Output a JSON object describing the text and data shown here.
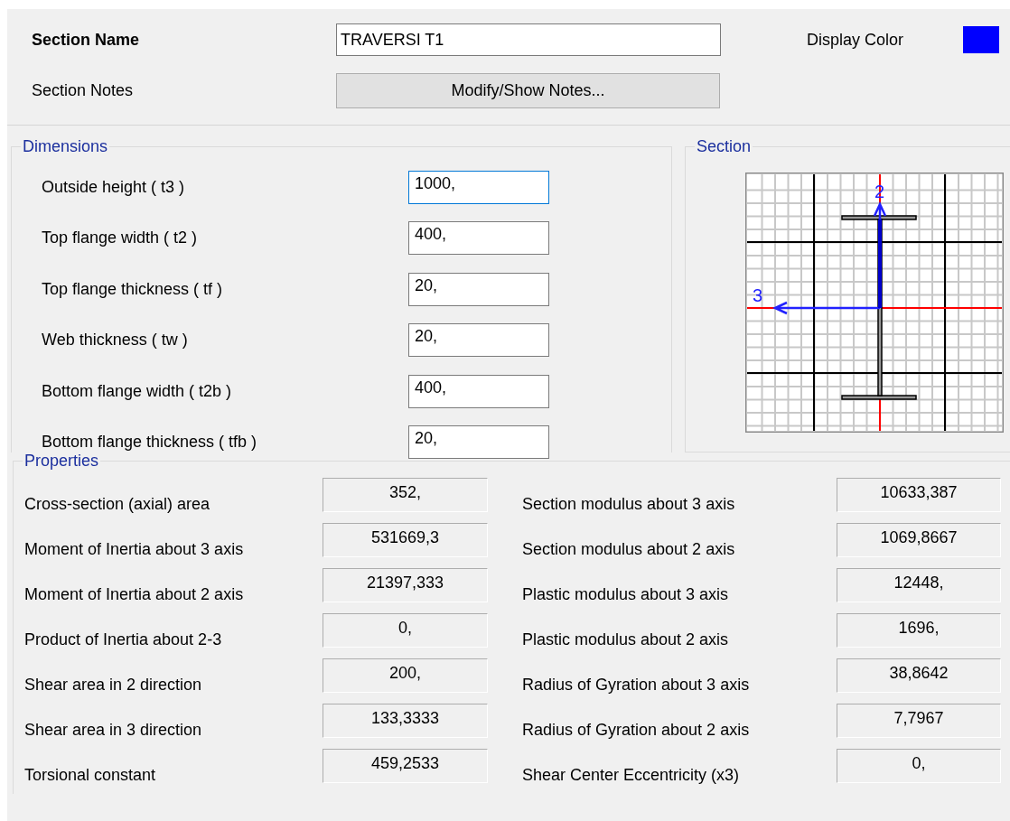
{
  "section_name": {
    "label": "Section Name",
    "value": "TRAVERSI T1"
  },
  "display_color": {
    "label": "Display Color",
    "color": "#0000ff"
  },
  "section_notes": {
    "label": "Section Notes",
    "button": "Modify/Show Notes..."
  },
  "dimensions": {
    "title": "Dimensions",
    "fields": [
      {
        "label": "Outside height  ( t3 )",
        "value": "1000,",
        "focused": true
      },
      {
        "label": "Top flange width  ( t2 )",
        "value": "400,",
        "focused": false
      },
      {
        "label": "Top flange thickness  ( tf )",
        "value": "20,",
        "focused": false
      },
      {
        "label": "Web thickness  ( tw )",
        "value": "20,",
        "focused": false
      },
      {
        "label": "Bottom flange width  ( t2b )",
        "value": "400,",
        "focused": false
      },
      {
        "label": "Bottom flange thickness  ( tfb )",
        "value": "20,",
        "focused": false
      }
    ]
  },
  "section": {
    "title": "Section",
    "axis_2": "2",
    "axis_3": "3"
  },
  "properties": {
    "title": "Properties",
    "rows": [
      {
        "left_label": "Cross-section (axial) area",
        "left_value": "352,",
        "right_label": "Section modulus about 3 axis",
        "right_value": "10633,387"
      },
      {
        "left_label": "Moment of Inertia about 3 axis",
        "left_value": "531669,3",
        "right_label": "Section modulus about 2 axis",
        "right_value": "1069,8667"
      },
      {
        "left_label": "Moment of Inertia about 2 axis",
        "left_value": "21397,333",
        "right_label": "Plastic modulus about 3 axis",
        "right_value": "12448,"
      },
      {
        "left_label": "Product of Inertia about 2-3",
        "left_value": "0,",
        "right_label": "Plastic modulus about 2 axis",
        "right_value": "1696,"
      },
      {
        "left_label": "Shear area in 2 direction",
        "left_value": "200,",
        "right_label": "Radius of Gyration about 3 axis",
        "right_value": "38,8642"
      },
      {
        "left_label": "Shear area in 3 direction",
        "left_value": "133,3333",
        "right_label": "Radius of Gyration about 2 axis",
        "right_value": "7,7967"
      },
      {
        "left_label": "Torsional constant",
        "left_value": "459,2533",
        "right_label": "Shear Center Eccentricity (x3)",
        "right_value": "0,"
      }
    ]
  }
}
